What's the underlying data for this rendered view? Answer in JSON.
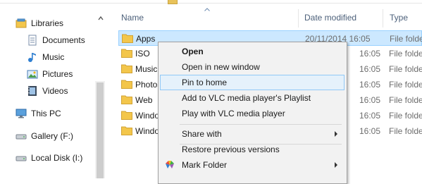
{
  "nav": {
    "items": [
      {
        "label": "Libraries",
        "icon": "libraries-icon"
      },
      {
        "label": "Documents",
        "icon": "documents-icon"
      },
      {
        "label": "Music",
        "icon": "music-icon"
      },
      {
        "label": "Pictures",
        "icon": "pictures-icon"
      },
      {
        "label": "Videos",
        "icon": "videos-icon"
      },
      {
        "label": "This PC",
        "icon": "this-pc-icon"
      },
      {
        "label": "Gallery (F:)",
        "icon": "drive-icon"
      },
      {
        "label": "Local Disk (I:)",
        "icon": "drive-icon"
      }
    ]
  },
  "columns": {
    "name": "Name",
    "date": "Date modified",
    "type": "Type"
  },
  "rows": [
    {
      "name": "Apps",
      "date": "20/11/2014 16:05",
      "type": "File folder"
    },
    {
      "name": "ISO",
      "date": "16:05",
      "type": "File folder"
    },
    {
      "name": "Music",
      "date": "16:05",
      "type": "File folder"
    },
    {
      "name": "Photos",
      "date": "16:05",
      "type": "File folder"
    },
    {
      "name": "Web",
      "date": "16:05",
      "type": "File folder"
    },
    {
      "name": "Windows",
      "date": "16:05",
      "type": "File folder"
    },
    {
      "name": "Windows",
      "date": "16:05",
      "type": "File folder"
    }
  ],
  "context_menu": {
    "items": [
      {
        "label": "Open"
      },
      {
        "label": "Open in new window"
      },
      {
        "label": "Pin to home"
      },
      {
        "label": "Add to VLC media player's Playlist"
      },
      {
        "label": "Play with VLC media player"
      },
      {
        "label": "Share with"
      },
      {
        "label": "Restore previous versions"
      },
      {
        "label": "Mark Folder"
      }
    ]
  },
  "colors": {
    "selection": "#cce8ff",
    "selection_border": "#99d1ff",
    "menu_hover": "#e5f1fb",
    "menu_hover_border": "#90c8f6",
    "folder": "#f3c64b"
  }
}
